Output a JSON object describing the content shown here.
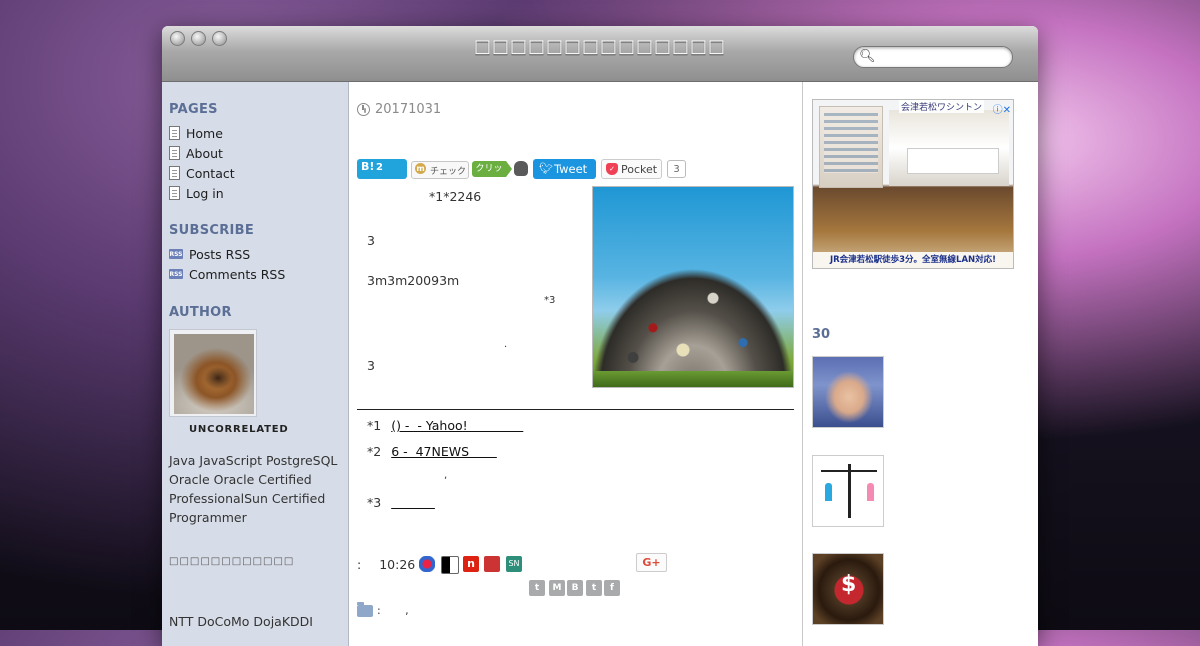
{
  "window": {
    "title": "□□□□□□□□□□□□□□"
  },
  "search": {
    "placeholder": ""
  },
  "sidebar": {
    "pages_heading": "PAGES",
    "pages": [
      {
        "label": "Home"
      },
      {
        "label": "About"
      },
      {
        "label": "Contact"
      },
      {
        "label": "Log in"
      }
    ],
    "subscribe_heading": "SUBSCRIBE",
    "feeds": [
      {
        "label": "Posts RSS"
      },
      {
        "label": "Comments RSS"
      }
    ],
    "author_heading": "AUTHOR",
    "author_name": "UNCORRELATED",
    "bio": "Java JavaScript PostgreSQL Oracle Oracle Certified ProfessionalSun Certified Programmer",
    "tofu_line": "□□□□□□□□□□□□",
    "ntt_line": "NTT DoCoMo DojaKDDI"
  },
  "post": {
    "date": "20171031",
    "share": {
      "hatena_badge": "B!",
      "hatena_count": "2",
      "mixi_label": "チェック",
      "evernote_label": "クリップ",
      "tweet_label": "Tweet",
      "pocket_label": "Pocket",
      "pocket_count": "3"
    },
    "body": {
      "line1": "*1*2246",
      "line2": "3",
      "line3": "3m3m20093m",
      "line4": "*3",
      "line5": ".",
      "line6": "3"
    },
    "footnotes": [
      {
        "marker": "*1",
        "link": "() -  - Yahoo!              "
      },
      {
        "marker": "*2",
        "link": "6 -  47NEWS       "
      },
      {
        "marker": "dot",
        "text": ","
      },
      {
        "marker": "*3",
        "link": "           "
      }
    ],
    "meta": {
      "colon": ":",
      "time": "10:26",
      "google_plus": "G+",
      "category_text": ":       ,"
    },
    "social_glyphs": [
      "t",
      "M",
      "B",
      "t",
      "f"
    ]
  },
  "right_sidebar": {
    "ad": {
      "brand": "会津若松ワシントン",
      "info": "ⓘ✕",
      "caption": "JR会津若松駅徒歩3分。全室無線LAN対応!"
    },
    "section_heading": "30"
  },
  "colors": {
    "sidebar_bg": "#d7dde8",
    "heading": "#5b6e95",
    "hatena": "#21a3dc",
    "twitter": "#1b95e0",
    "pocket": "#ef4056"
  }
}
